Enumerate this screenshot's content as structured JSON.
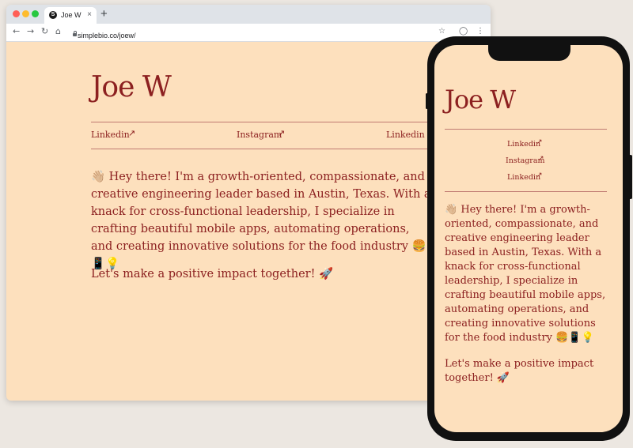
{
  "browser": {
    "tab_title": "Joe W",
    "favicon_letter": "S",
    "tab_close": "×",
    "new_tab": "+",
    "url": "simplebio.co/joew/",
    "nav": {
      "back": "←",
      "forward": "→",
      "reload": "↻",
      "home": "⌂"
    },
    "toolbar": {
      "bookmark": "☆",
      "profile": "◯",
      "menu": "⋮"
    }
  },
  "profile": {
    "name": "Joe W",
    "links": [
      {
        "label": "Linkedin",
        "arrow": "↗"
      },
      {
        "label": "Instagram",
        "arrow": "↗"
      },
      {
        "label": "Linkedin",
        "arrow": "↗"
      }
    ],
    "bio": "👋🏼 Hey there! I'm a growth-oriented, compassionate, and creative engineering leader based in Austin, Texas. With a knack for cross-functional leadership, I specialize in crafting beautiful mobile apps, automating operations, and creating innovative solutions for the food industry 🍔📱💡",
    "cta": "Let's make a positive impact together! 🚀"
  },
  "colors": {
    "background": "#fde0bd",
    "accent": "#8c2020",
    "divider": "#c07b72"
  }
}
